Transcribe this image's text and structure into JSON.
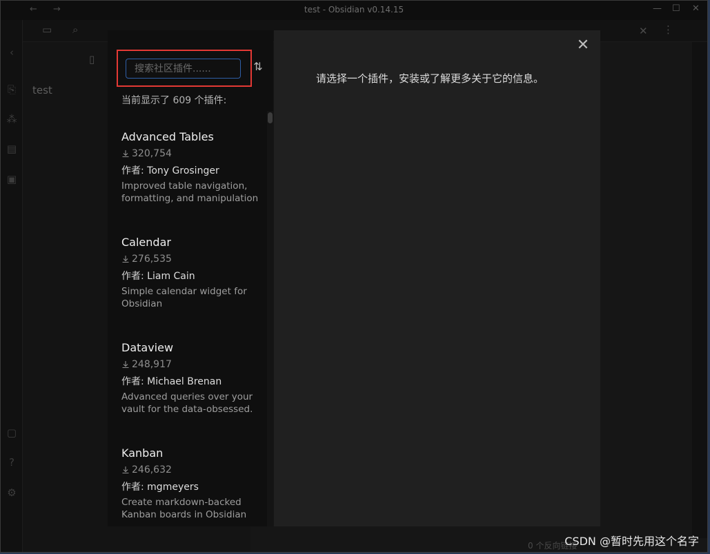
{
  "window": {
    "title": "test - Obsidian v0.14.15"
  },
  "background": {
    "file_item": "test",
    "status_text": "0 个反向链接"
  },
  "modal": {
    "search": {
      "placeholder": "搜索社区插件......",
      "value": ""
    },
    "sort_icon": "sort-arrows-icon",
    "count_text": "当前显示了 609 个插件:",
    "author_label": "作者:",
    "plugins": [
      {
        "name": "Advanced Tables",
        "downloads": "320,754",
        "author": "Tony Grosinger",
        "description": "Improved table navigation, formatting, and manipulation"
      },
      {
        "name": "Calendar",
        "downloads": "276,535",
        "author": "Liam Cain",
        "description": "Simple calendar widget for Obsidian"
      },
      {
        "name": "Dataview",
        "downloads": "248,917",
        "author": "Michael Brenan",
        "description": "Advanced queries over your vault for the data-obsessed."
      },
      {
        "name": "Kanban",
        "downloads": "246,632",
        "author": "mgmeyers",
        "description": "Create markdown-backed Kanban boards in Obsidian"
      }
    ],
    "close_icon": "close-icon",
    "detail_empty_text": "请选择一个插件，安装或了解更多关于它的信息。"
  },
  "watermark": "CSDN @暂时先用这个名字",
  "colors": {
    "highlight_border": "#e53935",
    "input_focus": "#2f5fa8",
    "modal_left_bg": "#0f0f0f",
    "modal_right_bg": "#202020"
  }
}
